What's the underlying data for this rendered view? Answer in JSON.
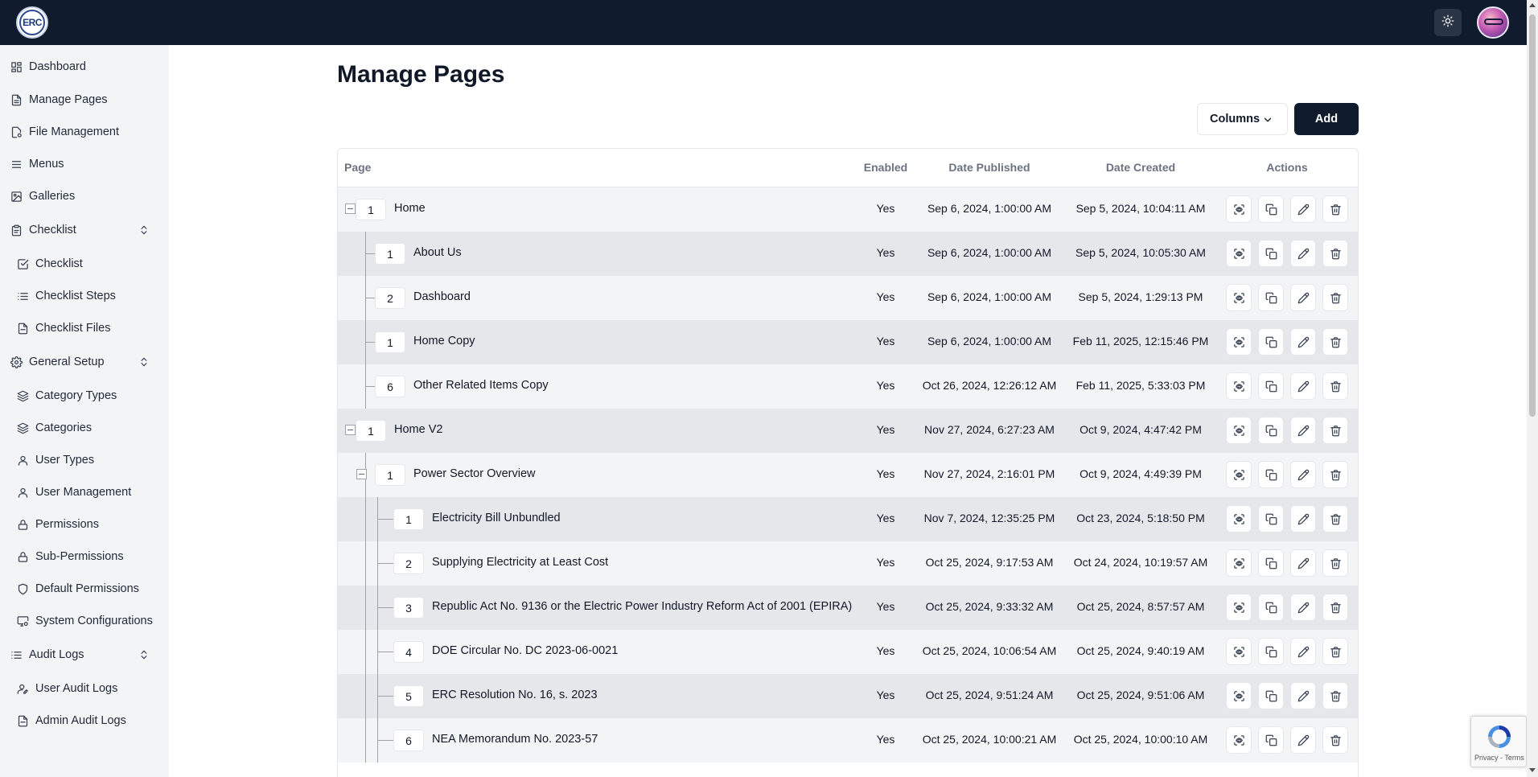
{
  "header": {
    "logo_text": "ERC",
    "theme_toggle_icon": "sun-icon",
    "avatar_icon": "user-avatar"
  },
  "sidebar": {
    "items": [
      {
        "label": "Dashboard",
        "icon": "dashboard-icon",
        "level": "top"
      },
      {
        "label": "Manage Pages",
        "icon": "file-text-icon",
        "level": "top"
      },
      {
        "label": "File Management",
        "icon": "file-settings-icon",
        "level": "top"
      },
      {
        "label": "Menus",
        "icon": "menu-icon",
        "level": "top"
      },
      {
        "label": "Galleries",
        "icon": "image-icon",
        "level": "top"
      },
      {
        "label": "Checklist",
        "icon": "clipboard-icon",
        "level": "top",
        "expandable": true
      },
      {
        "label": "Checklist",
        "icon": "checkbox-icon",
        "level": "sub"
      },
      {
        "label": "Checklist Steps",
        "icon": "list-icon",
        "level": "sub"
      },
      {
        "label": "Checklist Files",
        "icon": "file-icon",
        "level": "sub"
      },
      {
        "label": "General Setup",
        "icon": "gear-icon",
        "level": "top",
        "expandable": true
      },
      {
        "label": "Category Types",
        "icon": "layers-icon",
        "level": "sub"
      },
      {
        "label": "Categories",
        "icon": "layers-icon",
        "level": "sub"
      },
      {
        "label": "User Types",
        "icon": "user-icon",
        "level": "sub"
      },
      {
        "label": "User Management",
        "icon": "user-icon",
        "level": "sub"
      },
      {
        "label": "Permissions",
        "icon": "lock-icon",
        "level": "sub"
      },
      {
        "label": "Sub-Permissions",
        "icon": "lock-icon",
        "level": "sub"
      },
      {
        "label": "Default Permissions",
        "icon": "shield-icon",
        "level": "sub"
      },
      {
        "label": "System Configurations",
        "icon": "monitor-gear-icon",
        "level": "sub"
      },
      {
        "label": "Audit Logs",
        "icon": "list-icon",
        "level": "top",
        "expandable": true
      },
      {
        "label": "User Audit Logs",
        "icon": "user-pen-icon",
        "level": "sub"
      },
      {
        "label": "Admin Audit Logs",
        "icon": "file-icon",
        "level": "sub"
      }
    ]
  },
  "main": {
    "title": "Manage Pages",
    "columns_button": "Columns",
    "add_button": "Add",
    "table": {
      "headers": {
        "page": "Page",
        "enabled": "Enabled",
        "date_published": "Date Published",
        "date_created": "Date Created",
        "actions": "Actions"
      },
      "rows": [
        {
          "order": "1",
          "name": "Home",
          "enabled": "Yes",
          "published": "Sep 6, 2024, 1:00:00 AM",
          "created": "Sep 5, 2024, 10:04:11 AM",
          "depth": 0,
          "expandable": true
        },
        {
          "order": "1",
          "name": "About Us",
          "enabled": "Yes",
          "published": "Sep 6, 2024, 1:00:00 AM",
          "created": "Sep 5, 2024, 10:05:30 AM",
          "depth": 1,
          "expandable": false
        },
        {
          "order": "2",
          "name": "Dashboard",
          "enabled": "Yes",
          "published": "Sep 6, 2024, 1:00:00 AM",
          "created": "Sep 5, 2024, 1:29:13 PM",
          "depth": 1,
          "expandable": false
        },
        {
          "order": "1",
          "name": "Home Copy",
          "enabled": "Yes",
          "published": "Sep 6, 2024, 1:00:00 AM",
          "created": "Feb 11, 2025, 12:15:46 PM",
          "depth": 1,
          "expandable": false
        },
        {
          "order": "6",
          "name": "Other Related Items Copy",
          "enabled": "Yes",
          "published": "Oct 26, 2024, 12:26:12 AM",
          "created": "Feb 11, 2025, 5:33:03 PM",
          "depth": 1,
          "expandable": false
        },
        {
          "order": "1",
          "name": "Home V2",
          "enabled": "Yes",
          "published": "Nov 27, 2024, 6:27:23 AM",
          "created": "Oct 9, 2024, 4:47:42 PM",
          "depth": 0,
          "expandable": true
        },
        {
          "order": "1",
          "name": "Power Sector Overview",
          "enabled": "Yes",
          "published": "Nov 27, 2024, 2:16:01 PM",
          "created": "Oct 9, 2024, 4:49:39 PM",
          "depth": 1,
          "expandable": true
        },
        {
          "order": "1",
          "name": "Electricity Bill Unbundled",
          "enabled": "Yes",
          "published": "Nov 7, 2024, 12:35:25 PM",
          "created": "Oct 23, 2024, 5:18:50 PM",
          "depth": 2,
          "expandable": false
        },
        {
          "order": "2",
          "name": "Supplying Electricity at Least Cost",
          "enabled": "Yes",
          "published": "Oct 25, 2024, 9:17:53 AM",
          "created": "Oct 24, 2024, 10:19:57 AM",
          "depth": 2,
          "expandable": false
        },
        {
          "order": "3",
          "name": "Republic Act No. 9136 or the Electric Power Industry Reform Act of 2001 (EPIRA)",
          "enabled": "Yes",
          "published": "Oct 25, 2024, 9:33:32 AM",
          "created": "Oct 25, 2024, 8:57:57 AM",
          "depth": 2,
          "expandable": false
        },
        {
          "order": "4",
          "name": "DOE Circular No. DC 2023-06-0021",
          "enabled": "Yes",
          "published": "Oct 25, 2024, 10:06:54 AM",
          "created": "Oct 25, 2024, 9:40:19 AM",
          "depth": 2,
          "expandable": false
        },
        {
          "order": "5",
          "name": "ERC Resolution No. 16, s. 2023",
          "enabled": "Yes",
          "published": "Oct 25, 2024, 9:51:24 AM",
          "created": "Oct 25, 2024, 9:51:06 AM",
          "depth": 2,
          "expandable": false
        },
        {
          "order": "6",
          "name": "NEA Memorandum No. 2023-57",
          "enabled": "Yes",
          "published": "Oct 25, 2024, 10:00:21 AM",
          "created": "Oct 25, 2024, 10:00:10 AM",
          "depth": 2,
          "expandable": false
        }
      ],
      "row_actions": [
        "preview-icon",
        "copy-icon",
        "edit-icon",
        "trash-icon"
      ]
    }
  },
  "recaptcha": {
    "text": "Privacy - Terms"
  }
}
